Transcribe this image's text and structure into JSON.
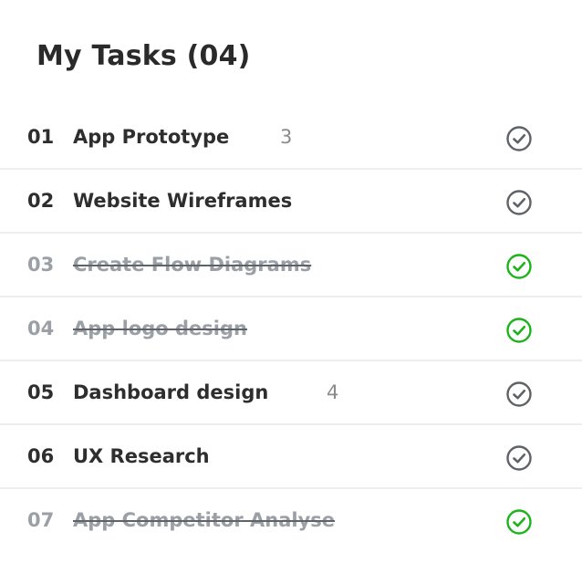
{
  "header": {
    "title": "My Tasks (04)"
  },
  "colors": {
    "pending_check": "#5f6368",
    "done_check": "#1db31d",
    "divider": "#eeeeee"
  },
  "tasks": [
    {
      "number": "01",
      "title": "App Prototype",
      "count": "3",
      "done": false
    },
    {
      "number": "02",
      "title": "Website Wireframes",
      "count": "",
      "done": false
    },
    {
      "number": "03",
      "title": "Create Flow Diagrams",
      "count": "",
      "done": true
    },
    {
      "number": "04",
      "title": "App logo design",
      "count": "",
      "done": true
    },
    {
      "number": "05",
      "title": "Dashboard design",
      "count": "4",
      "done": false
    },
    {
      "number": "06",
      "title": "UX Research",
      "count": "",
      "done": false
    },
    {
      "number": "07",
      "title": "App Competitor Analyse",
      "count": "",
      "done": true
    }
  ]
}
